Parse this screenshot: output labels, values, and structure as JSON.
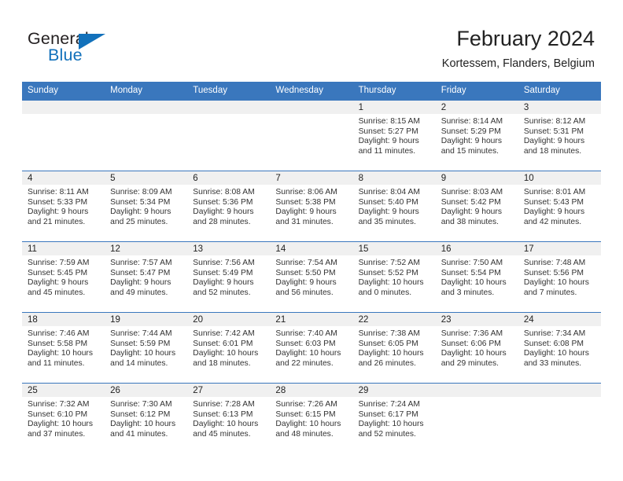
{
  "brand": {
    "name_top": "General",
    "name_bottom": "Blue",
    "accent_color": "#1271bb",
    "triangle_icon": "triangle-icon"
  },
  "header": {
    "title": "February 2024",
    "subtitle": "Kortessem, Flanders, Belgium"
  },
  "theme": {
    "header_row_bg": "#3a77bd",
    "daynum_band_bg": "#f0f0f0",
    "grid_line": "#3a77bd",
    "text": "#333333"
  },
  "calendar": {
    "weekday_headers": [
      "Sunday",
      "Monday",
      "Tuesday",
      "Wednesday",
      "Thursday",
      "Friday",
      "Saturday"
    ],
    "weeks": [
      [
        {
          "day": "",
          "lines": []
        },
        {
          "day": "",
          "lines": []
        },
        {
          "day": "",
          "lines": []
        },
        {
          "day": "",
          "lines": []
        },
        {
          "day": "1",
          "lines": [
            "Sunrise: 8:15 AM",
            "Sunset: 5:27 PM",
            "Daylight: 9 hours",
            "and 11 minutes."
          ]
        },
        {
          "day": "2",
          "lines": [
            "Sunrise: 8:14 AM",
            "Sunset: 5:29 PM",
            "Daylight: 9 hours",
            "and 15 minutes."
          ]
        },
        {
          "day": "3",
          "lines": [
            "Sunrise: 8:12 AM",
            "Sunset: 5:31 PM",
            "Daylight: 9 hours",
            "and 18 minutes."
          ]
        }
      ],
      [
        {
          "day": "4",
          "lines": [
            "Sunrise: 8:11 AM",
            "Sunset: 5:33 PM",
            "Daylight: 9 hours",
            "and 21 minutes."
          ]
        },
        {
          "day": "5",
          "lines": [
            "Sunrise: 8:09 AM",
            "Sunset: 5:34 PM",
            "Daylight: 9 hours",
            "and 25 minutes."
          ]
        },
        {
          "day": "6",
          "lines": [
            "Sunrise: 8:08 AM",
            "Sunset: 5:36 PM",
            "Daylight: 9 hours",
            "and 28 minutes."
          ]
        },
        {
          "day": "7",
          "lines": [
            "Sunrise: 8:06 AM",
            "Sunset: 5:38 PM",
            "Daylight: 9 hours",
            "and 31 minutes."
          ]
        },
        {
          "day": "8",
          "lines": [
            "Sunrise: 8:04 AM",
            "Sunset: 5:40 PM",
            "Daylight: 9 hours",
            "and 35 minutes."
          ]
        },
        {
          "day": "9",
          "lines": [
            "Sunrise: 8:03 AM",
            "Sunset: 5:42 PM",
            "Daylight: 9 hours",
            "and 38 minutes."
          ]
        },
        {
          "day": "10",
          "lines": [
            "Sunrise: 8:01 AM",
            "Sunset: 5:43 PM",
            "Daylight: 9 hours",
            "and 42 minutes."
          ]
        }
      ],
      [
        {
          "day": "11",
          "lines": [
            "Sunrise: 7:59 AM",
            "Sunset: 5:45 PM",
            "Daylight: 9 hours",
            "and 45 minutes."
          ]
        },
        {
          "day": "12",
          "lines": [
            "Sunrise: 7:57 AM",
            "Sunset: 5:47 PM",
            "Daylight: 9 hours",
            "and 49 minutes."
          ]
        },
        {
          "day": "13",
          "lines": [
            "Sunrise: 7:56 AM",
            "Sunset: 5:49 PM",
            "Daylight: 9 hours",
            "and 52 minutes."
          ]
        },
        {
          "day": "14",
          "lines": [
            "Sunrise: 7:54 AM",
            "Sunset: 5:50 PM",
            "Daylight: 9 hours",
            "and 56 minutes."
          ]
        },
        {
          "day": "15",
          "lines": [
            "Sunrise: 7:52 AM",
            "Sunset: 5:52 PM",
            "Daylight: 10 hours",
            "and 0 minutes."
          ]
        },
        {
          "day": "16",
          "lines": [
            "Sunrise: 7:50 AM",
            "Sunset: 5:54 PM",
            "Daylight: 10 hours",
            "and 3 minutes."
          ]
        },
        {
          "day": "17",
          "lines": [
            "Sunrise: 7:48 AM",
            "Sunset: 5:56 PM",
            "Daylight: 10 hours",
            "and 7 minutes."
          ]
        }
      ],
      [
        {
          "day": "18",
          "lines": [
            "Sunrise: 7:46 AM",
            "Sunset: 5:58 PM",
            "Daylight: 10 hours",
            "and 11 minutes."
          ]
        },
        {
          "day": "19",
          "lines": [
            "Sunrise: 7:44 AM",
            "Sunset: 5:59 PM",
            "Daylight: 10 hours",
            "and 14 minutes."
          ]
        },
        {
          "day": "20",
          "lines": [
            "Sunrise: 7:42 AM",
            "Sunset: 6:01 PM",
            "Daylight: 10 hours",
            "and 18 minutes."
          ]
        },
        {
          "day": "21",
          "lines": [
            "Sunrise: 7:40 AM",
            "Sunset: 6:03 PM",
            "Daylight: 10 hours",
            "and 22 minutes."
          ]
        },
        {
          "day": "22",
          "lines": [
            "Sunrise: 7:38 AM",
            "Sunset: 6:05 PM",
            "Daylight: 10 hours",
            "and 26 minutes."
          ]
        },
        {
          "day": "23",
          "lines": [
            "Sunrise: 7:36 AM",
            "Sunset: 6:06 PM",
            "Daylight: 10 hours",
            "and 29 minutes."
          ]
        },
        {
          "day": "24",
          "lines": [
            "Sunrise: 7:34 AM",
            "Sunset: 6:08 PM",
            "Daylight: 10 hours",
            "and 33 minutes."
          ]
        }
      ],
      [
        {
          "day": "25",
          "lines": [
            "Sunrise: 7:32 AM",
            "Sunset: 6:10 PM",
            "Daylight: 10 hours",
            "and 37 minutes."
          ]
        },
        {
          "day": "26",
          "lines": [
            "Sunrise: 7:30 AM",
            "Sunset: 6:12 PM",
            "Daylight: 10 hours",
            "and 41 minutes."
          ]
        },
        {
          "day": "27",
          "lines": [
            "Sunrise: 7:28 AM",
            "Sunset: 6:13 PM",
            "Daylight: 10 hours",
            "and 45 minutes."
          ]
        },
        {
          "day": "28",
          "lines": [
            "Sunrise: 7:26 AM",
            "Sunset: 6:15 PM",
            "Daylight: 10 hours",
            "and 48 minutes."
          ]
        },
        {
          "day": "29",
          "lines": [
            "Sunrise: 7:24 AM",
            "Sunset: 6:17 PM",
            "Daylight: 10 hours",
            "and 52 minutes."
          ]
        },
        {
          "day": "",
          "lines": []
        },
        {
          "day": "",
          "lines": []
        }
      ]
    ]
  }
}
